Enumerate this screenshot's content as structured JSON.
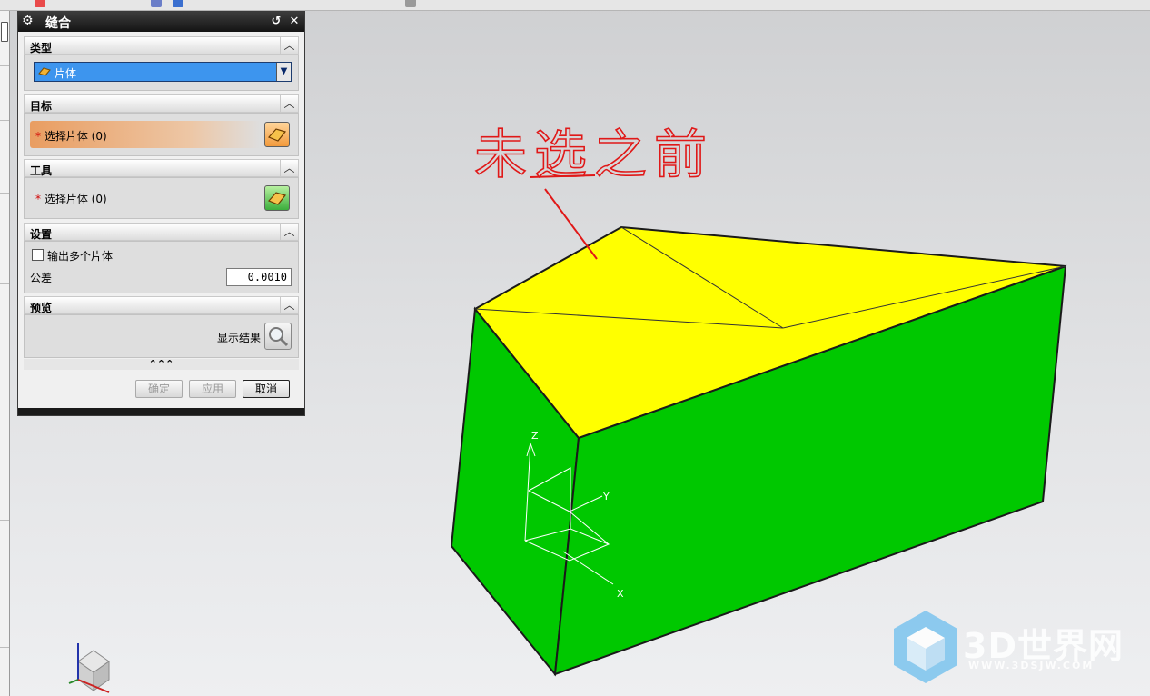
{
  "dialog": {
    "title": "缝合",
    "sections": {
      "type": {
        "label": "类型",
        "selected": "片体"
      },
      "target": {
        "label": "目标",
        "select_label": "选择片体 (0)"
      },
      "tool": {
        "label": "工具",
        "select_label": "选择片体 (0)"
      },
      "settings": {
        "label": "设置",
        "multi_output_label": "输出多个片体",
        "tolerance_label": "公差",
        "tolerance_value": "0.0010"
      },
      "preview": {
        "label": "预览",
        "show_result_label": "显示结果"
      }
    },
    "required_marker": "*",
    "buttons": {
      "ok": "确定",
      "apply": "应用",
      "cancel": "取消"
    }
  },
  "viewport": {
    "annotation": "未选之前",
    "axes": {
      "z": "Z",
      "y": "Y",
      "x": "X"
    },
    "colors": {
      "top_face": "#ffff00",
      "side_face": "#00c800",
      "annotation": "#e01818"
    }
  },
  "watermark": {
    "brand": "3D世界网",
    "url": "WWW.3DSJW.COM"
  }
}
